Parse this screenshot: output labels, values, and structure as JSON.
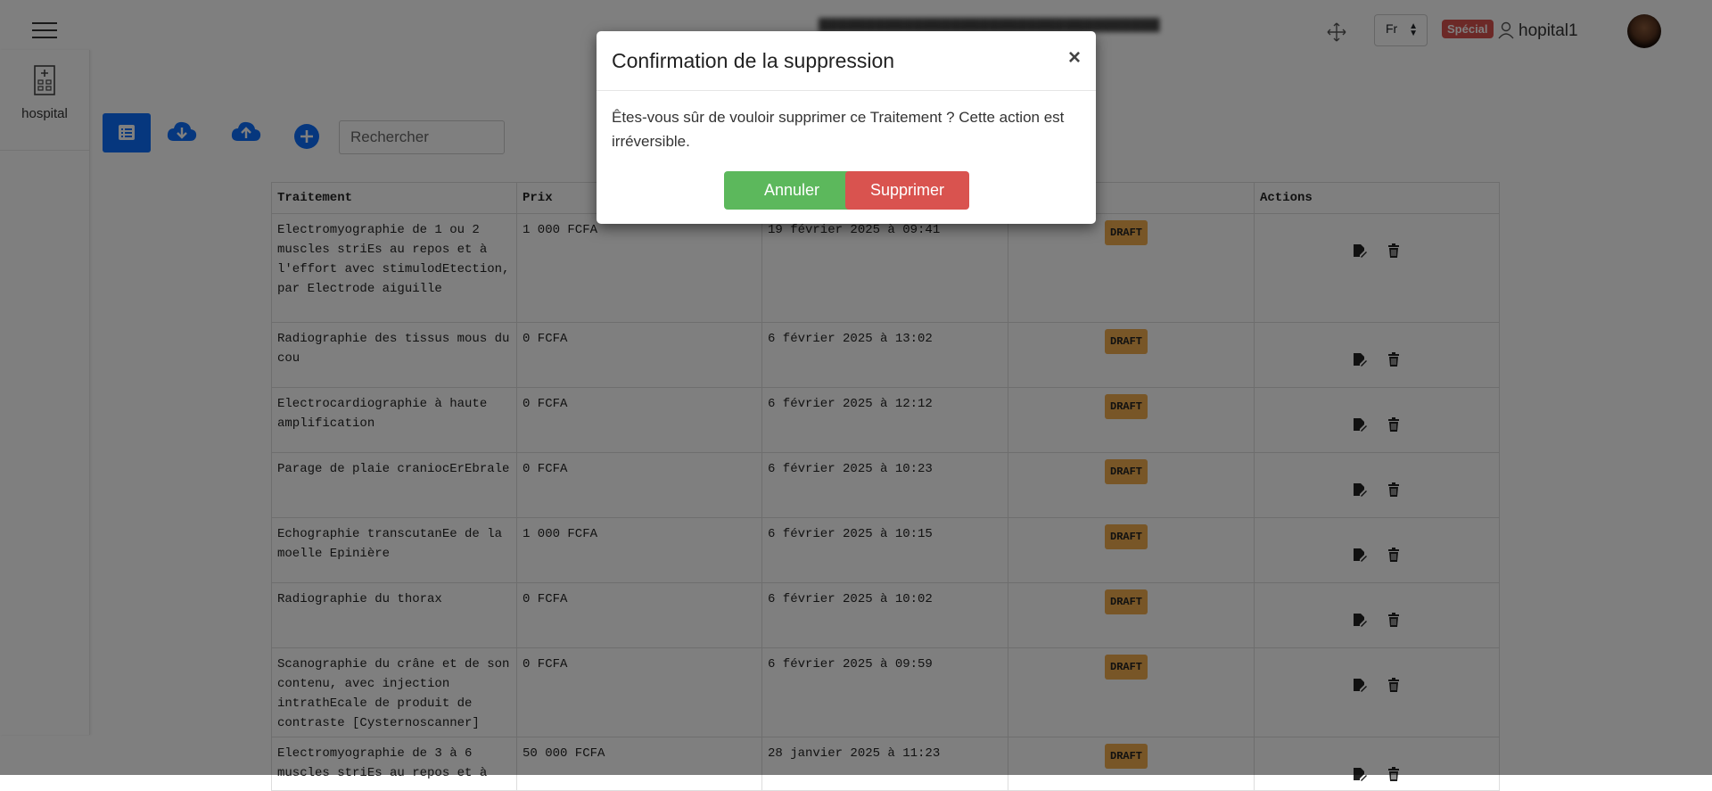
{
  "header": {
    "lang": "Fr",
    "special_badge": "Spécial",
    "username": "hopital1"
  },
  "sidebar": {
    "items": [
      {
        "label": "hospital"
      }
    ]
  },
  "toolbar": {
    "search_placeholder": "Rechercher"
  },
  "table": {
    "columns": [
      "Traitement",
      "Prix",
      "",
      "",
      "Actions"
    ],
    "rows": [
      {
        "name": "Electromyographie de 1 ou 2 muscles striEs au repos et à l'effort avec stimulodEtection, par Electrode aiguille",
        "price": "1 000 FCFA",
        "date": "19 février 2025 à 09:41",
        "status": "DRAFT"
      },
      {
        "name": "Radiographie des tissus mous du cou",
        "price": "0 FCFA",
        "date": "6 février 2025 à 13:02",
        "status": "DRAFT"
      },
      {
        "name": "Electrocardiographie à haute amplification",
        "price": "0 FCFA",
        "date": "6 février 2025 à 12:12",
        "status": "DRAFT"
      },
      {
        "name": "Parage de plaie craniocErEbrale",
        "price": "0 FCFA",
        "date": "6 février 2025 à 10:23",
        "status": "DRAFT"
      },
      {
        "name": "Echographie transcutanEe de la moelle Epinière",
        "price": "1 000 FCFA",
        "date": "6 février 2025 à 10:15",
        "status": "DRAFT"
      },
      {
        "name": "Radiographie du thorax",
        "price": "0 FCFA",
        "date": "6 février 2025 à 10:02",
        "status": "DRAFT"
      },
      {
        "name": "Scanographie du crâne et de son contenu, avec injection intrathEcale de produit de contraste [Cysternoscanner]",
        "price": "0 FCFA",
        "date": "6 février 2025 à 09:59",
        "status": "DRAFT"
      },
      {
        "name": "Electromyographie de 3 à 6 muscles striEs au repos et à",
        "price": "50 000 FCFA",
        "date": "28 janvier 2025 à 11:23",
        "status": "DRAFT"
      }
    ]
  },
  "modal": {
    "title": "Confirmation de la suppression",
    "close": "×",
    "body": "Êtes-vous sûr de vouloir supprimer ce Traitement ? Cette action est irréversible.",
    "cancel_label": "Annuler",
    "delete_label": "Supprimer"
  },
  "colors": {
    "primary": "#0d6efd",
    "draft_badge": "#f0ad4e",
    "special_badge": "#d9534f",
    "cancel_button": "#5cb85c",
    "delete_button": "#d9534f"
  }
}
